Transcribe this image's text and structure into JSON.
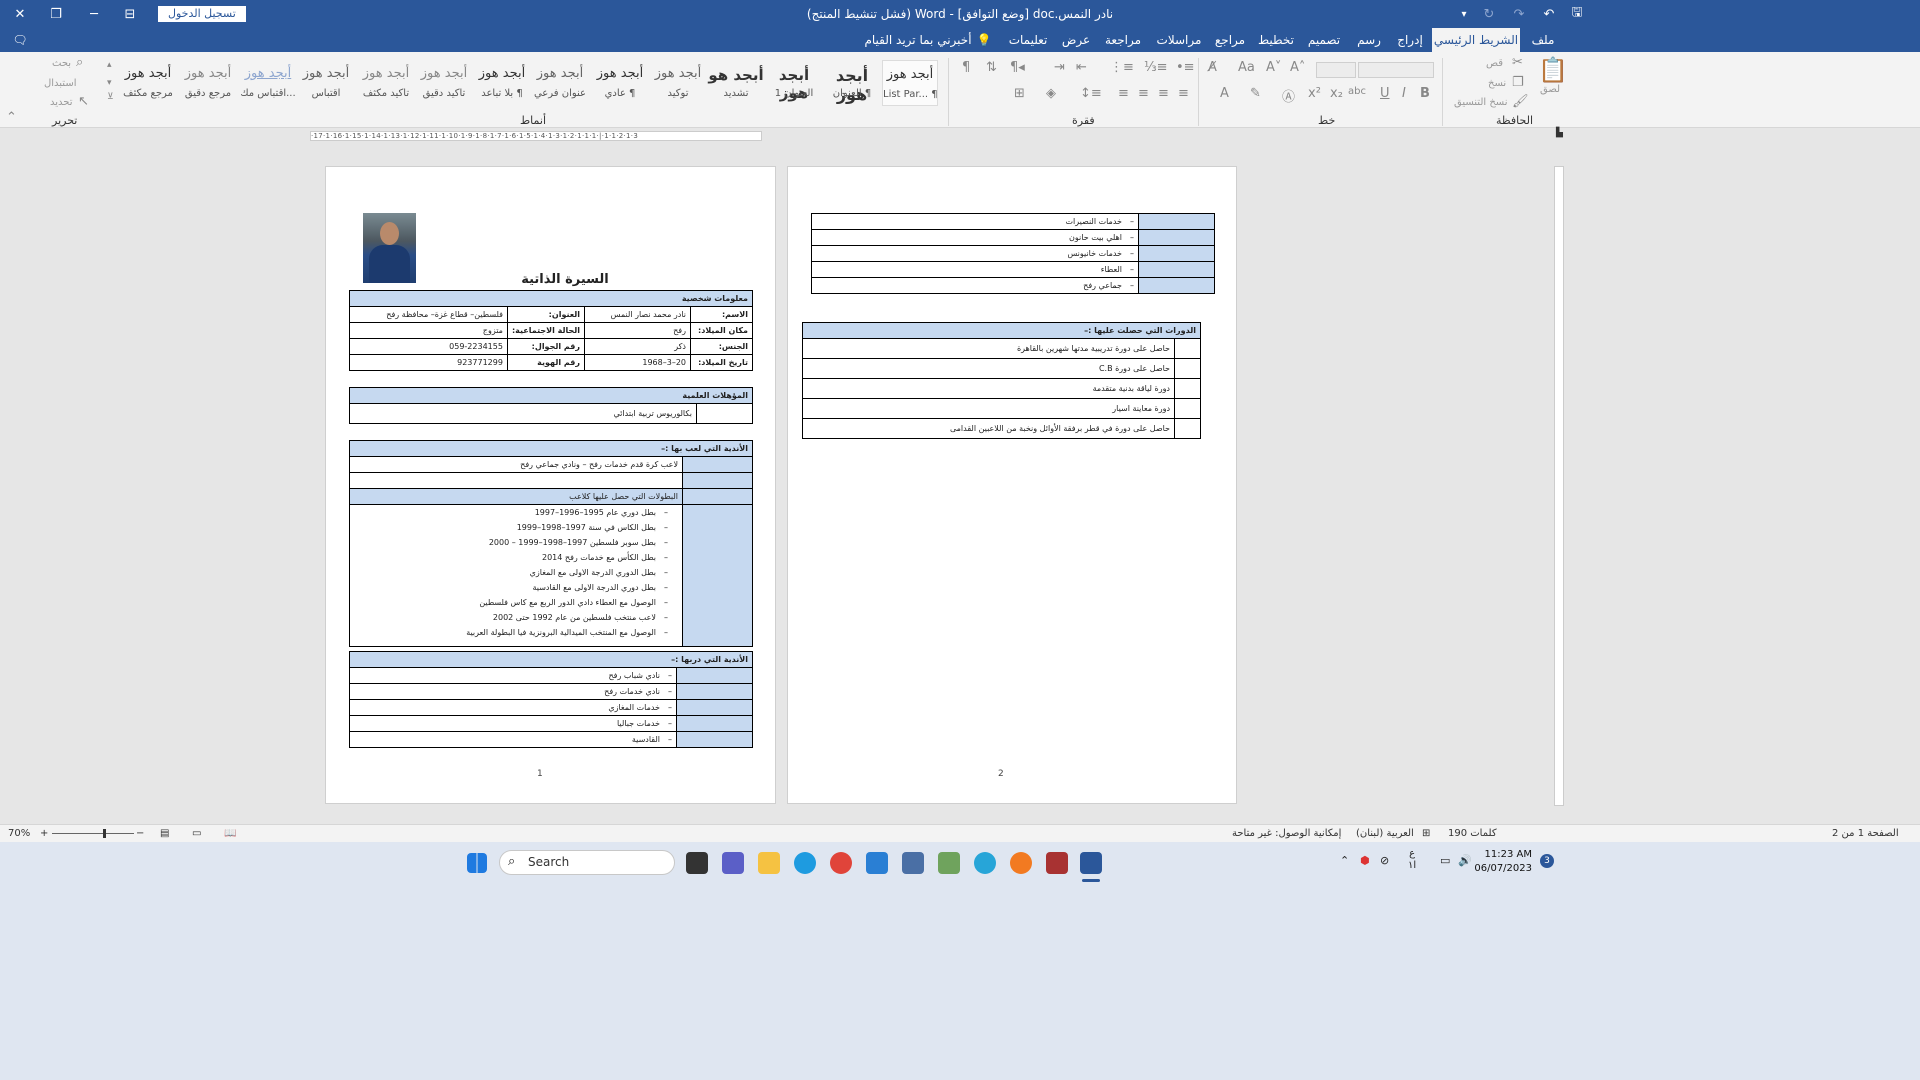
{
  "window": {
    "signin_label": "تسجيل الدخول",
    "title": "نادر النمس.doc [وضع التوافق] - Word (فشل تنشيط المنتج)",
    "close_glyph": "✕",
    "restore_glyph": "❐",
    "minimize_glyph": "─",
    "ribbon_display_glyph": "⊟",
    "comments_glyph": "🗨"
  },
  "tabs": [
    "ملف",
    "الشريط الرئيسي",
    "إدراج",
    "رسم",
    "تصميم",
    "تخطيط",
    "مراجع",
    "مراسلات",
    "مراجعة",
    "عرض",
    "تعليمات"
  ],
  "tell_me": "أخبرني بما تريد القيام به",
  "ribbon": {
    "groups": {
      "clipboard": "الحافظة",
      "font": "خط",
      "paragraph": "فقرة",
      "styles": "أنماط",
      "editing": "تحرير"
    },
    "clipboard_items": [
      "قص",
      "نسخ",
      "نسخ التنسيق",
      "لصق"
    ],
    "editing_items": [
      "بحث",
      "استبدال",
      "تحديد"
    ],
    "styles": [
      {
        "sample": "أبجد هوز",
        "name": "List Par... ¶"
      },
      {
        "sample": "أبجد هوز",
        "name": "العنوان ¶"
      },
      {
        "sample": "أبجد هوز",
        "name": "العنوان 1"
      },
      {
        "sample": "أبجد هو",
        "name": "تشديد"
      },
      {
        "sample": "أبجد هوز",
        "name": "توكيد"
      },
      {
        "sample": "أبجد هوز",
        "name": "عادي ¶"
      },
      {
        "sample": "أبجد هوز",
        "name": "عنوان فرعي"
      },
      {
        "sample": "أبجد هوز",
        "name": "بلا تباعد ¶"
      },
      {
        "sample": "أبجد هوز",
        "name": "تأكيد دقيق"
      },
      {
        "sample": "أبجد هوز",
        "name": "تأكيد مكثف"
      },
      {
        "sample": "أبجد هوز",
        "name": "اقتباس"
      },
      {
        "sample": "أبجد هوز",
        "name": "اقتباس مك..."
      },
      {
        "sample": "أبجد هوز",
        "name": "مرجع دقيق"
      },
      {
        "sample": "أبجد هوز",
        "name": "مرجع مكثف"
      }
    ]
  },
  "ruler_text": "·17·1·16·1·15·1·14·1·13·1·12·1·11·1·10·1·9·1·8·1·7·1·6·1·5·1·4·1·3·1·2·1·1·1·|·1·1·2·1·3",
  "page1": {
    "title": "السيرة الذاتية",
    "personal": {
      "header": "معلومات شخصية",
      "rows": [
        {
          "l1": "الاسم:",
          "v1": "نادر محمد نصار النمس",
          "l2": "العنوان:",
          "v2": "فلسطين– قطاع غزة– محافظة رفح"
        },
        {
          "l1": "مكان الميلاد:",
          "v1": "رفح",
          "l2": "الحالة الاجتماعية:",
          "v2": "متزوج"
        },
        {
          "l1": "الجنس:",
          "v1": "ذكر",
          "l2": "رقم الجوال:",
          "v2": "059-2234155"
        },
        {
          "l1": "تاريخ الميلاد:",
          "v1": "20–3–1968",
          "l2": "رقم الهوية",
          "v2": "923771299"
        }
      ]
    },
    "quals": {
      "header": "المؤهلات العلمية",
      "value": "بكالوريوس تربية ابتدائي"
    },
    "clubs_played": {
      "header": "الأندية التي لعب بها :–",
      "line": "لاعب كرة قدم خدمات رفح – ونادي جماعي رفح",
      "championships_header": "البطولات التي حصل عليها كلاعب",
      "items": [
        "بطل دوري عام 1995–1996–1997",
        "بطل الكاس في سنة 1997–1998–1999",
        "بطل سوبر فلسطين 1997–1998–1999 – 2000",
        "بطل الكأس مع خدمات رفح 2014",
        "بطل الدوري الدرجة الاولى مع المغازي",
        "بطل دوري الدرجة الاولى مع القادسية",
        "الوصول مع العطاء دادي الدور الربع مع كاس فلسطين",
        "لاعب منتخب فلسطين من عام 1992 حتى 2002",
        "الوصول مع المنتخب الميدالية البرونزية فيا البطولة العربية"
      ]
    },
    "clubs_coached": {
      "header": "الأندية التي دربها :–",
      "items": [
        "نادي شباب رفح",
        "نادي خدمات رفح",
        "خدمات المغازي",
        "خدمات جباليا",
        "القادسية"
      ]
    },
    "page_number": "1"
  },
  "page2": {
    "clubs_cont": [
      "خدمات النصيرات",
      "اهلي بيت حانون",
      "خدمات خانيونس",
      "العطاء",
      "جماعي رفح"
    ],
    "courses": {
      "header": "الدورات التي حصلت عليها :–",
      "items": [
        "حاصل على دورة تدريبية مدتها شهرين بالقاهرة",
        "حاصل على دورة C.B",
        "دورة لياقة بدنية متقدمة",
        "دورة معاينة اسيار",
        "حاصل على دورة في قطر برفقة الأوائل ونخبة من اللاعبين القدامى"
      ]
    },
    "page_number": "2"
  },
  "status": {
    "page": "الصفحة 1 من 2",
    "words": "190 كلمات",
    "language": "العربية (لبنان)",
    "accessibility": "إمكانية الوصول: غير متاحة",
    "zoom": "70%"
  },
  "taskbar": {
    "search_placeholder": "Search",
    "time": "11:23 AM",
    "date": "06/07/2023",
    "lang": "ع",
    "notifications": "3",
    "lang2": "ا١"
  },
  "colors": {
    "accent": "#2b579a",
    "table_header": "#c6d9f0"
  }
}
